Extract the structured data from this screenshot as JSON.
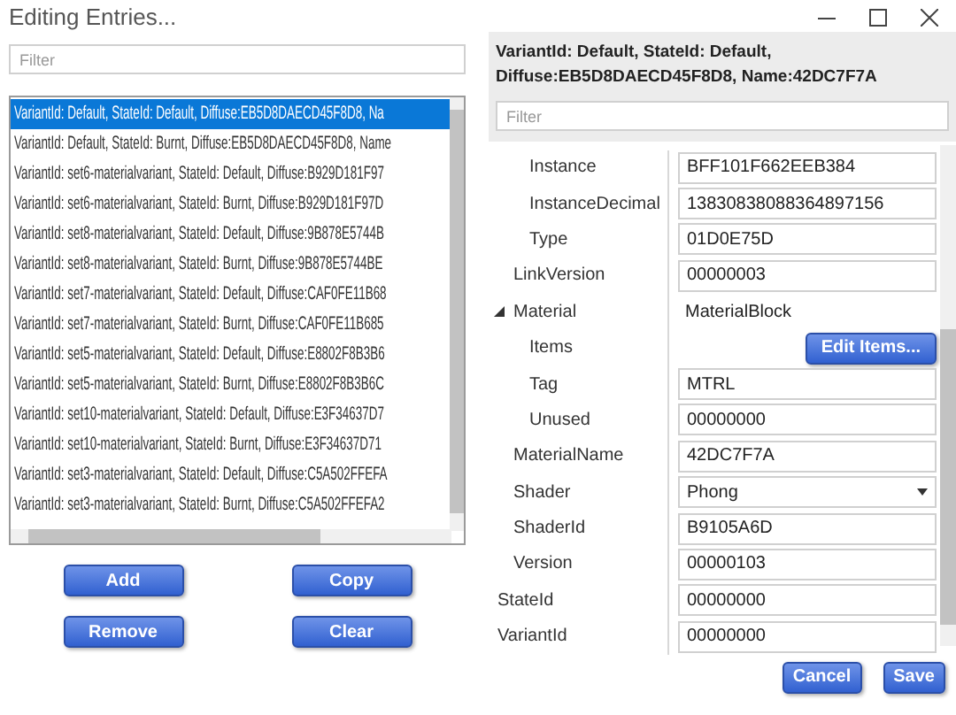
{
  "window": {
    "title": "Editing Entries..."
  },
  "left": {
    "filter": {
      "placeholder": "Filter"
    },
    "entries": [
      {
        "text": "VariantId: Default, StateId: Default, Diffuse:EB5D8DAECD45F8D8, Na",
        "selected": true
      },
      {
        "text": "VariantId: Default, StateId: Burnt, Diffuse:EB5D8DAECD45F8D8, Name",
        "selected": false
      },
      {
        "text": "VariantId: set6-materialvariant, StateId: Default, Diffuse:B929D181F97",
        "selected": false
      },
      {
        "text": "VariantId: set6-materialvariant, StateId: Burnt, Diffuse:B929D181F97D",
        "selected": false
      },
      {
        "text": "VariantId: set8-materialvariant, StateId: Default, Diffuse:9B878E5744B",
        "selected": false
      },
      {
        "text": "VariantId: set8-materialvariant, StateId: Burnt, Diffuse:9B878E5744BE",
        "selected": false
      },
      {
        "text": "VariantId: set7-materialvariant, StateId: Default, Diffuse:CAF0FE11B68",
        "selected": false
      },
      {
        "text": "VariantId: set7-materialvariant, StateId: Burnt, Diffuse:CAF0FE11B685",
        "selected": false
      },
      {
        "text": "VariantId: set5-materialvariant, StateId: Default, Diffuse:E8802F8B3B6",
        "selected": false
      },
      {
        "text": "VariantId: set5-materialvariant, StateId: Burnt, Diffuse:E8802F8B3B6C",
        "selected": false
      },
      {
        "text": "VariantId: set10-materialvariant, StateId: Default, Diffuse:E3F34637D7",
        "selected": false
      },
      {
        "text": "VariantId: set10-materialvariant, StateId: Burnt, Diffuse:E3F34637D71",
        "selected": false
      },
      {
        "text": "VariantId: set3-materialvariant, StateId: Default, Diffuse:C5A502FFEFA",
        "selected": false
      },
      {
        "text": "VariantId: set3-materialvariant, StateId: Burnt, Diffuse:C5A502FFEFA2",
        "selected": false
      }
    ],
    "buttons": [
      "Add",
      "Copy",
      "Remove",
      "Clear"
    ]
  },
  "right": {
    "heading": "VariantId: Default, StateId: Default, Diffuse:EB5D8DAECD45F8D8, Name:42DC7F7A",
    "filter": {
      "placeholder": "Filter"
    },
    "properties": [
      {
        "children": [
          {
            "children": [
              {
                "label": "Instance",
                "kind": "text",
                "value": "BFF101F662EEB384"
              },
              {
                "label": "InstanceDecimal",
                "kind": "text",
                "value": "13830838088364897156"
              },
              {
                "label": "Type",
                "kind": "text",
                "value": "01D0E75D"
              }
            ]
          },
          {
            "label": "LinkVersion",
            "kind": "text",
            "value": "00000003"
          },
          {
            "label": "Material",
            "kind": "plain",
            "value": "MaterialBlock",
            "expanded": true,
            "children": [
              {
                "label": "Items",
                "kind": "button",
                "value": "Edit Items..."
              },
              {
                "label": "Tag",
                "kind": "text",
                "value": "MTRL"
              },
              {
                "label": "Unused",
                "kind": "text",
                "value": "00000000"
              }
            ]
          },
          {
            "label": "MaterialName",
            "kind": "text",
            "value": "42DC7F7A"
          },
          {
            "label": "Shader",
            "kind": "dropdown",
            "value": "Phong"
          },
          {
            "label": "ShaderId",
            "kind": "text",
            "value": "B9105A6D"
          },
          {
            "label": "Version",
            "kind": "text",
            "value": "00000103"
          }
        ]
      },
      {
        "label": "StateId",
        "kind": "text",
        "value": "00000000"
      },
      {
        "label": "VariantId",
        "kind": "text",
        "value": "00000000"
      }
    ],
    "buttons": [
      "Cancel",
      "Save"
    ]
  }
}
